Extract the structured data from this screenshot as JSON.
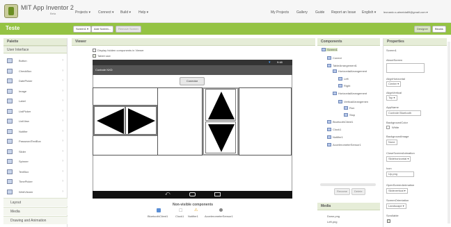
{
  "app": {
    "title": "MIT App Inventor 2",
    "subtitle": "Beta"
  },
  "topmenu": {
    "projects": "Projects ▾",
    "connect": "Connect ▾",
    "build": "Build ▾",
    "help": "Help ▾",
    "my_projects": "My Projects",
    "gallery": "Gallery",
    "guide": "Guide",
    "report": "Report an Issue",
    "english": "English ▾",
    "account": "leonardo.s.almeida89@gmail.com ▾"
  },
  "toolbar": {
    "project_name": "Teste",
    "screen_select": "Screen1 ▾",
    "add_screen": "Add Screen...",
    "remove_screen": "Remove Screen",
    "designer": "Designer",
    "blocks": "Blocks"
  },
  "palette": {
    "title": "Palette",
    "section": "User Interface",
    "items": [
      {
        "label": "Button",
        "icon": "button-icon"
      },
      {
        "label": "CheckBox",
        "icon": "checkbox-icon"
      },
      {
        "label": "DatePicker",
        "icon": "datepicker-icon"
      },
      {
        "label": "Image",
        "icon": "image-icon"
      },
      {
        "label": "Label",
        "icon": "label-icon"
      },
      {
        "label": "ListPicker",
        "icon": "listpicker-icon"
      },
      {
        "label": "ListView",
        "icon": "listview-icon"
      },
      {
        "label": "Notifier",
        "icon": "notifier-icon"
      },
      {
        "label": "PasswordTextBox",
        "icon": "password-icon"
      },
      {
        "label": "Slider",
        "icon": "slider-icon"
      },
      {
        "label": "Spinner",
        "icon": "spinner-icon"
      },
      {
        "label": "TextBox",
        "icon": "textbox-icon"
      },
      {
        "label": "TimePicker",
        "icon": "timepicker-icon"
      },
      {
        "label": "WebViewer",
        "icon": "webviewer-icon"
      }
    ],
    "sections": [
      "Layout",
      "Media",
      "Drawing and Animation"
    ]
  },
  "viewer": {
    "title": "Viewer",
    "check_hidden": "Display hidden components in Viewer",
    "check_preview": "Tablet size",
    "screen_title": "Controle NXD",
    "status_time": "9:48",
    "conectar": "Conectar",
    "nonvisible_title": "Non-visible components",
    "nonvisible": [
      "BluetoothClient1",
      "Clock1",
      "Notifier1",
      "AccelerometerSensor1"
    ]
  },
  "components": {
    "title": "Components",
    "tree": [
      {
        "label": "Screen1",
        "depth": 0
      },
      {
        "label": "Conect",
        "depth": 1
      },
      {
        "label": "TableArrangement1",
        "depth": 1
      },
      {
        "label": "HorizontalArrangement",
        "depth": 2
      },
      {
        "label": "Left",
        "depth": 3
      },
      {
        "label": "Right",
        "depth": 3
      },
      {
        "label": "HorizontalArrangement",
        "depth": 2
      },
      {
        "label": "VerticalArrangemen",
        "depth": 3
      },
      {
        "label": "Run",
        "depth": 4
      },
      {
        "label": "Stop",
        "depth": 4
      },
      {
        "label": "BluetoothClient1",
        "depth": 1
      },
      {
        "label": "Clock1",
        "depth": 1
      },
      {
        "label": "Notifier1",
        "depth": 1
      },
      {
        "label": "AccelerometerSensor1",
        "depth": 1
      }
    ],
    "rename": "Rename",
    "delete": "Delete",
    "media_title": "Media",
    "media": [
      "Down.png",
      "Left.png"
    ]
  },
  "properties": {
    "title": "Properties",
    "component": "Screen1",
    "about_label": "AboutScreen",
    "align_h_label": "AlignHorizontal",
    "align_h_value": "Center ▾",
    "align_v_label": "AlignVertical",
    "align_v_value": "Top ▾",
    "appname_label": "AppName",
    "appname_value": "Controle Bluetooth",
    "bgcolor_label": "BackgroundColor",
    "bgcolor_value": "White",
    "bgimage_label": "BackgroundImage",
    "bgimage_value": "None",
    "close_anim_label": "CloseScreenAnimation",
    "close_anim_value": "Slidehorizontal ▾",
    "icon_label": "Icon",
    "icon_value": "Up.png",
    "open_anim_label": "OpenScreenAnimation",
    "open_anim_value": "Slidevertical ▾",
    "orientation_label": "ScreenOrientation",
    "orientation_value": "Landscape ▾",
    "scrollable_label": "Scrollable"
  },
  "colors": {
    "green": "#94c343",
    "panel_head": "#e6edd8"
  }
}
